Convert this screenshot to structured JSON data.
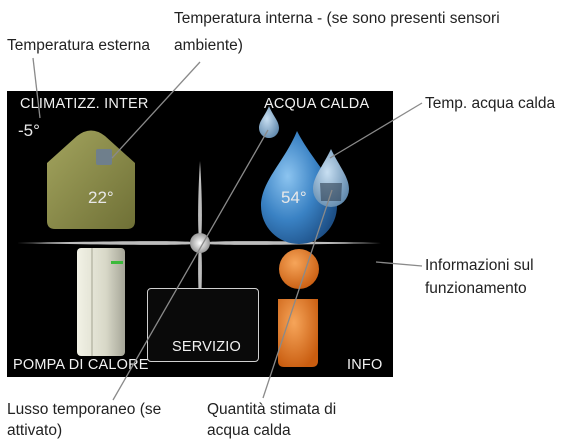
{
  "annotations": {
    "temp_esterna": "Temperatura esterna",
    "temp_interna_line1": "Temperatura interna - (se sono presenti sensori",
    "temp_interna_line2": "ambiente)",
    "temp_acqua": "Temp. acqua calda",
    "info_line1": "Informazioni sul",
    "info_line2": "funzionamento",
    "lusso_line1": "Lusso temporaneo (se",
    "lusso_line2": "attivato)",
    "quantita_line1": "Quantità stimata di",
    "quantita_line2": "acqua calda"
  },
  "screen": {
    "climatizz_label": "CLIMATIZZ. INTER",
    "acqua_label": "ACQUA CALDA",
    "pompa_label": "POMPA DI CALORE",
    "servizio_label": "SERVIZIO",
    "info_label": "INFO",
    "outdoor_temp": "-5°",
    "indoor_temp": "22°",
    "water_temp": "54°"
  },
  "colors": {
    "house": "#8d8e4c",
    "water_drop": "#3a82c4",
    "info_icon": "#e87a1e",
    "leader_line": "#8a8a8a"
  },
  "icons": [
    "house-icon",
    "water-drop-icon",
    "heat-pump-icon",
    "wrench-icon",
    "info-icon",
    "sparkle-icon"
  ]
}
